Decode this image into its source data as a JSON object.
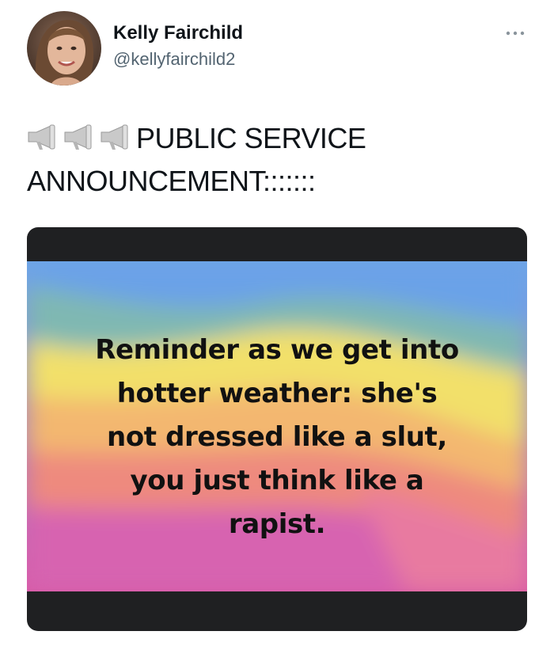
{
  "tweet": {
    "display_name": "Kelly Fairchild",
    "handle": "@kellyfairchild2",
    "text_line1": "PUBLIC SERVICE",
    "text_line2": "ANNOUNCEMENT:::::::",
    "emoji": "megaphone-icon x3"
  },
  "media": {
    "lines": [
      "Reminder as we get into",
      "hotter weather: she's",
      "not dressed like a slut,",
      "you just think like a",
      "rapist."
    ]
  },
  "colors": {
    "name": "#0f1419",
    "handle": "#536471",
    "media_frame": "#1f2022"
  }
}
